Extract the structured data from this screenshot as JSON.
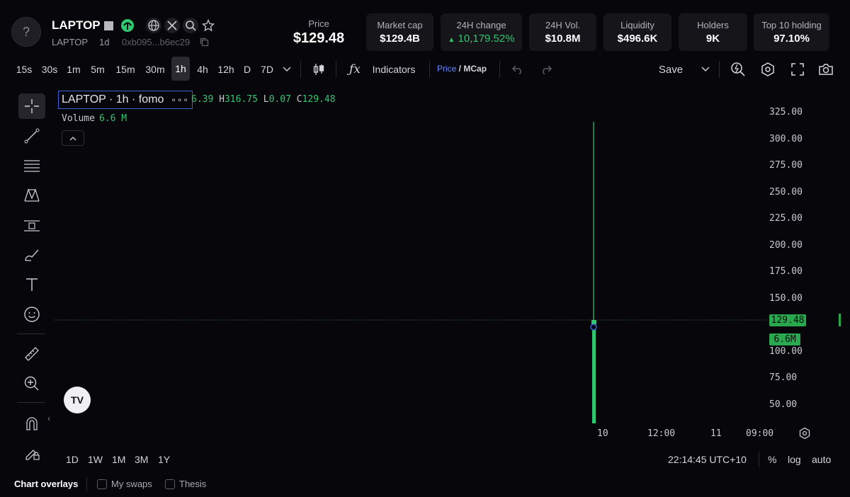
{
  "header": {
    "logo_glyph": "?",
    "token_name": "LAPTOP",
    "ticker": "LAPTOP",
    "timeframe": "1d",
    "address": "0xb095...b6ec29",
    "price_label": "Price",
    "price_value": "$129.48",
    "stats": [
      {
        "label": "Market cap",
        "value": "$129.4B",
        "trend": "none"
      },
      {
        "label": "24H change",
        "value": "10,179.52%",
        "trend": "up"
      },
      {
        "label": "24H Vol.",
        "value": "$10.8M",
        "trend": "none"
      },
      {
        "label": "Liquidity",
        "value": "$496.6K",
        "trend": "none"
      },
      {
        "label": "Holders",
        "value": "9K",
        "trend": "none"
      },
      {
        "label": "Top 10 holding",
        "value": "97.10%",
        "trend": "none"
      }
    ]
  },
  "toolbar": {
    "intervals": [
      "15s",
      "30s",
      "1m",
      "5m",
      "15m",
      "30m",
      "1h",
      "4h",
      "12h",
      "D",
      "7D"
    ],
    "active_interval": "1h",
    "indicators_label": "Indicators",
    "price_label": "Price",
    "mcap_label": "MCap",
    "save_label": "Save"
  },
  "chart": {
    "legend_title": "LAPTOP · 1h · fomo",
    "legend_more": "∘∘∘",
    "ohlc": {
      "o_partial": "6.39",
      "h_key": "H",
      "h": "316.75",
      "l_key": "L",
      "l": "0.07",
      "c_key": "C",
      "c": "129.48"
    },
    "volume_label": "Volume",
    "volume_value": "6.6 M",
    "price_axis": [
      "325.00",
      "300.00",
      "275.00",
      "250.00",
      "225.00",
      "200.00",
      "175.00",
      "150.00",
      "100.00",
      "75.00",
      "50.00"
    ],
    "last_price_tag": "129.48",
    "volume_tag": "6.6M",
    "time_axis": [
      "10",
      "12:00",
      "11",
      "09:00"
    ],
    "tv_logo": "TV",
    "ranges": [
      "1D",
      "1W",
      "1M",
      "3M",
      "1Y"
    ],
    "clock": "22:14:45 UTC+10",
    "pct_label": "%",
    "log_label": "log",
    "auto_label": "auto",
    "colors": {
      "up": "#2fc770",
      "accent": "#3b63d6",
      "tag": "#2aa84f"
    }
  },
  "overlays": {
    "title": "Chart overlays",
    "options": [
      "My swaps",
      "Thesis"
    ]
  }
}
